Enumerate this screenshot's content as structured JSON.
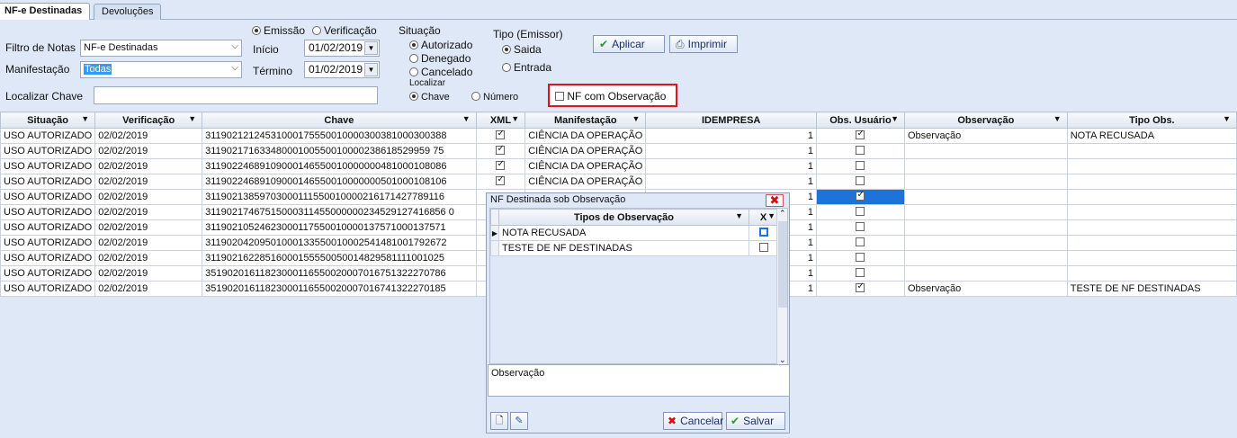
{
  "tabs": [
    {
      "label": "NF-e Destinadas",
      "active": true
    },
    {
      "label": "Devoluções",
      "active": false
    }
  ],
  "filters": {
    "filtro_label": "Filtro de Notas",
    "filtro_value": "NF-e Destinadas",
    "manifestacao_label": "Manifestação",
    "manifestacao_value": "Todas",
    "localizar_label": "Localizar Chave",
    "localizar_value": "",
    "data_tipo": {
      "emissao": "Emissão",
      "verificacao": "Verificação",
      "selected": "Emissão"
    },
    "inicio_label": "Início",
    "inicio_value": "01/02/2019",
    "termino_label": "Término",
    "termino_value": "01/02/2019",
    "situacao": {
      "title": "Situação",
      "options": [
        "Autorizado",
        "Denegado",
        "Cancelado"
      ],
      "selected": "Autorizado"
    },
    "tipo": {
      "title": "Tipo (Emissor)",
      "options": [
        "Saida",
        "Entrada"
      ],
      "selected": "Saida"
    },
    "localizar_por": {
      "title": "Localizar",
      "options": [
        "Chave",
        "Número"
      ],
      "selected": "Chave"
    },
    "nf_obs_label": "NF com Observação",
    "nf_obs_checked": false
  },
  "toolbar": {
    "aplicar_label": "Aplicar",
    "imprimir_label": "Imprimir"
  },
  "grid": {
    "columns": [
      "Situação",
      "Verificação",
      "Chave",
      "XML",
      "Manifestação",
      "IDEMPRESA",
      "Obs. Usuário",
      "Observação",
      "Tipo Obs."
    ],
    "rows": [
      {
        "situacao": "USO AUTORIZADO",
        "verificacao": "02/02/2019",
        "chave": "31190212124531000175550010000300381000300388",
        "xml": true,
        "manifestacao": "CIÊNCIA DA OPERAÇÃO",
        "idempresa": "1",
        "obs_usuario": true,
        "observacao": "Observação",
        "tipo_obs": "NOTA RECUSADA"
      },
      {
        "situacao": "USO AUTORIZADO",
        "verificacao": "02/02/2019",
        "chave": "31190217163348000100550010000238618529959 75",
        "xml": true,
        "manifestacao": "CIÊNCIA DA OPERAÇÃO",
        "idempresa": "1",
        "obs_usuario": false,
        "observacao": "",
        "tipo_obs": ""
      },
      {
        "situacao": "USO AUTORIZADO",
        "verificacao": "02/02/2019",
        "chave": "31190224689109000146550010000000481000108086",
        "xml": true,
        "manifestacao": "CIÊNCIA DA OPERAÇÃO",
        "idempresa": "1",
        "obs_usuario": false,
        "observacao": "",
        "tipo_obs": ""
      },
      {
        "situacao": "USO AUTORIZADO",
        "verificacao": "02/02/2019",
        "chave": "31190224689109000146550010000000501000108106",
        "xml": true,
        "manifestacao": "CIÊNCIA DA OPERAÇÃO",
        "idempresa": "1",
        "obs_usuario": false,
        "observacao": "",
        "tipo_obs": ""
      },
      {
        "situacao": "USO AUTORIZADO",
        "verificacao": "02/02/2019",
        "chave": "31190213859703000111550010000216171427789116",
        "xml": false,
        "manifestacao": "",
        "idempresa": "1",
        "obs_usuario": true,
        "observacao": "",
        "tipo_obs": "",
        "selected": true
      },
      {
        "situacao": "USO AUTORIZADO",
        "verificacao": "02/02/2019",
        "chave": "31190217467515000311455000000234529127416856 0",
        "xml": false,
        "manifestacao": "",
        "idempresa": "1",
        "obs_usuario": false,
        "observacao": "",
        "tipo_obs": ""
      },
      {
        "situacao": "USO AUTORIZADO",
        "verificacao": "02/02/2019",
        "chave": "31190210524623000117550010000137571000137571",
        "xml": false,
        "manifestacao": "",
        "idempresa": "1",
        "obs_usuario": false,
        "observacao": "",
        "tipo_obs": ""
      },
      {
        "situacao": "USO AUTORIZADO",
        "verificacao": "02/02/2019",
        "chave": "31190204209501000133550010002541481001792672",
        "xml": false,
        "manifestacao": "",
        "idempresa": "1",
        "obs_usuario": false,
        "observacao": "",
        "tipo_obs": ""
      },
      {
        "situacao": "USO AUTORIZADO",
        "verificacao": "02/02/2019",
        "chave": "31190216228516000155550050014829581111001025",
        "xml": false,
        "manifestacao": "",
        "idempresa": "1",
        "obs_usuario": false,
        "observacao": "",
        "tipo_obs": ""
      },
      {
        "situacao": "USO AUTORIZADO",
        "verificacao": "02/02/2019",
        "chave": "35190201611823000116550020007016751322270786",
        "xml": false,
        "manifestacao": "",
        "idempresa": "1",
        "obs_usuario": false,
        "observacao": "",
        "tipo_obs": ""
      },
      {
        "situacao": "USO AUTORIZADO",
        "verificacao": "02/02/2019",
        "chave": "35190201611823000116550020007016741322270185",
        "xml": false,
        "manifestacao": "",
        "idempresa": "1",
        "obs_usuario": true,
        "observacao": "Observação",
        "tipo_obs": "TESTE DE NF DESTINADAS"
      }
    ]
  },
  "dialog": {
    "title": "NF Destinada sob Observação",
    "columns": [
      "Tipos de Observação",
      "X"
    ],
    "rows": [
      {
        "label": "NOTA RECUSADA",
        "checked": false,
        "current": true
      },
      {
        "label": "TESTE DE NF DESTINADAS",
        "checked": false,
        "current": false
      }
    ],
    "obs_label": "Observação",
    "cancelar_label": "Cancelar",
    "salvar_label": "Salvar"
  }
}
